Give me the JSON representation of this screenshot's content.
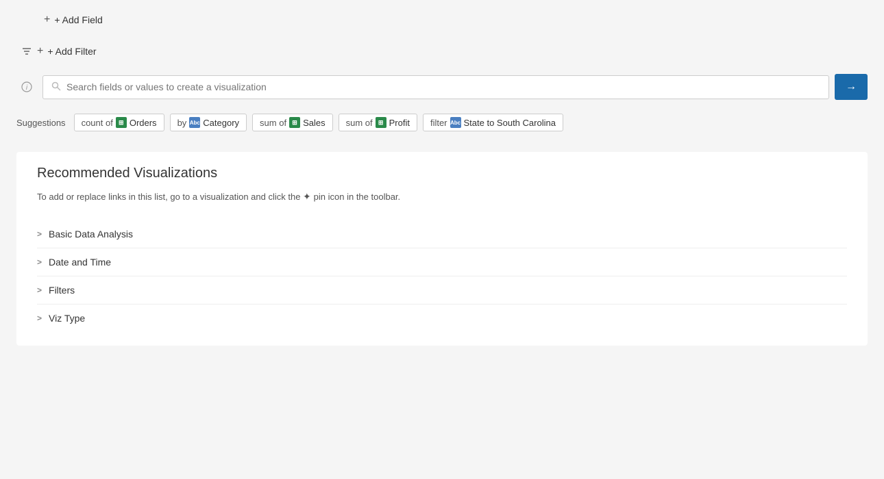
{
  "header": {
    "add_field_label": "+ Add Field",
    "add_filter_label": "+ Add Filter"
  },
  "search": {
    "placeholder": "Search fields or values to create a visualization"
  },
  "suggestions": {
    "label": "Suggestions",
    "chips": [
      {
        "type": "table",
        "prefix": "count of",
        "label": "Orders"
      },
      {
        "type": "abc",
        "prefix": "by",
        "label": "Category"
      },
      {
        "type": "table",
        "prefix": "sum of",
        "label": "Sales"
      },
      {
        "type": "table",
        "prefix": "sum of",
        "label": "Profit"
      },
      {
        "type": "abc",
        "prefix": "filter",
        "label": "State to South Carolina"
      }
    ]
  },
  "recommended": {
    "title": "Recommended Visualizations",
    "description": "To add or replace links in this list, go to a visualization and click the",
    "description_suffix": "pin icon in the toolbar.",
    "items": [
      {
        "label": "Basic Data Analysis"
      },
      {
        "label": "Date and Time"
      },
      {
        "label": "Filters"
      },
      {
        "label": "Viz Type"
      }
    ]
  },
  "icons": {
    "plus": "+",
    "chevron_right": ">",
    "arrow_right": "→",
    "info": "i",
    "filter": "⚗",
    "pin": "✦",
    "search": "🔍"
  }
}
